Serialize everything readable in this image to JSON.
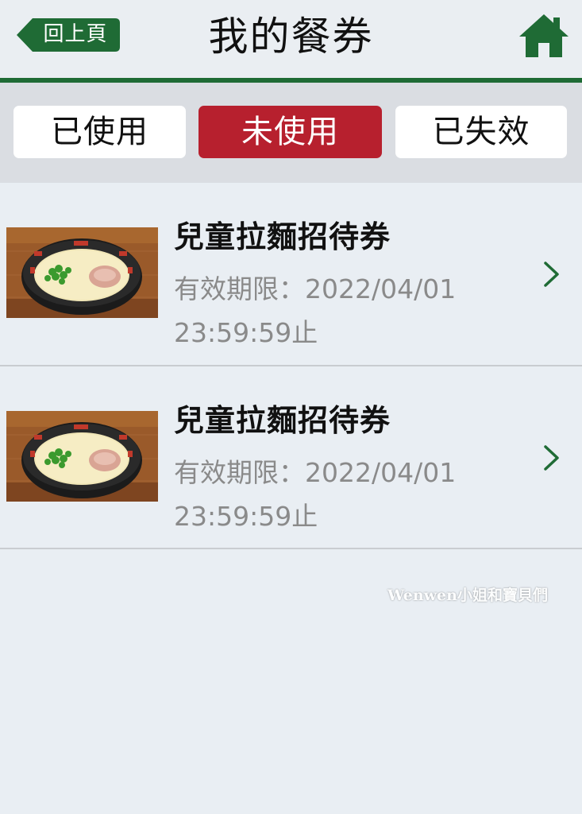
{
  "header": {
    "back_label": "回上頁",
    "title": "我的餐券",
    "home_icon": "home-icon",
    "accent_color": "#1f6b35"
  },
  "tabs": [
    {
      "label": "已使用",
      "selected": false
    },
    {
      "label": "未使用",
      "selected": true
    },
    {
      "label": "已失效",
      "selected": false
    }
  ],
  "selected_tab_color": "#b7202e",
  "coupons": [
    {
      "title": "兒童拉麵招待券",
      "validity_line1": "有效期限：2022/04/01",
      "validity_line2": "23:59:59止",
      "image": "ramen-bowl-image",
      "chevron_icon": "chevron-right-icon"
    },
    {
      "title": "兒童拉麵招待券",
      "validity_line1": "有效期限：2022/04/01",
      "validity_line2": "23:59:59止",
      "image": "ramen-bowl-image",
      "chevron_icon": "chevron-right-icon"
    }
  ],
  "watermark": "Wenwen小姐和寶貝們"
}
